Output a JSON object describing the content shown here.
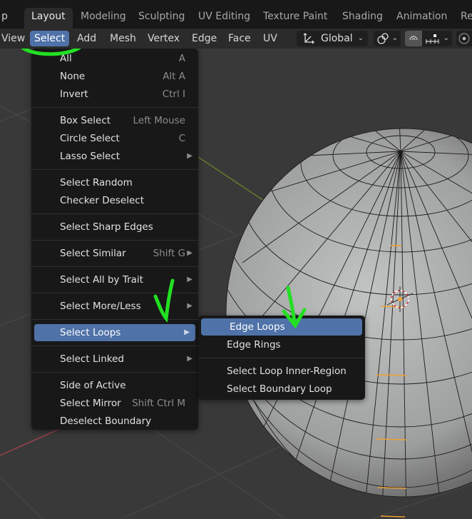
{
  "workspace_tabs": [
    "Layout",
    "Modeling",
    "Sculpting",
    "UV Editing",
    "Texture Paint",
    "Shading",
    "Animation",
    "Re"
  ],
  "active_workspace": "Layout",
  "header_menu": [
    "View",
    "Select",
    "Add",
    "Mesh",
    "Vertex",
    "Edge",
    "Face",
    "UV"
  ],
  "active_menu": "Select",
  "transform_orientation": "Global",
  "select_menu": {
    "groups": [
      [
        {
          "label": "All",
          "shortcut": "A"
        },
        {
          "label": "None",
          "shortcut": "Alt A"
        },
        {
          "label": "Invert",
          "shortcut": "Ctrl I"
        }
      ],
      [
        {
          "label": "Box Select",
          "shortcut": "Left Mouse"
        },
        {
          "label": "Circle Select",
          "shortcut": "C"
        },
        {
          "label": "Lasso Select",
          "submenu": true
        }
      ],
      [
        {
          "label": "Select Random"
        },
        {
          "label": "Checker Deselect"
        }
      ],
      [
        {
          "label": "Select Sharp Edges"
        }
      ],
      [
        {
          "label": "Select Similar",
          "shortcut": "Shift G",
          "submenu": true
        }
      ],
      [
        {
          "label": "Select All by Trait",
          "submenu": true
        }
      ],
      [
        {
          "label": "Select More/Less",
          "submenu": true
        }
      ],
      [
        {
          "label": "Select Loops",
          "submenu": true,
          "highlighted": true
        }
      ],
      [
        {
          "label": "Select Linked",
          "submenu": true
        }
      ],
      [
        {
          "label": "Side of Active"
        },
        {
          "label": "Select Mirror",
          "shortcut": "Shift Ctrl M"
        },
        {
          "label": "Deselect Boundary"
        }
      ]
    ]
  },
  "loops_submenu": {
    "groups": [
      [
        {
          "label": "Edge Loops",
          "highlighted": true
        },
        {
          "label": "Edge Rings"
        }
      ],
      [
        {
          "label": "Select Loop Inner-Region"
        },
        {
          "label": "Select Boundary Loop"
        }
      ]
    ]
  },
  "colors": {
    "accent": "#4f72a8",
    "menu_bg": "#181818",
    "selected_edge": "#f0a030",
    "annotation": "#22e022"
  }
}
